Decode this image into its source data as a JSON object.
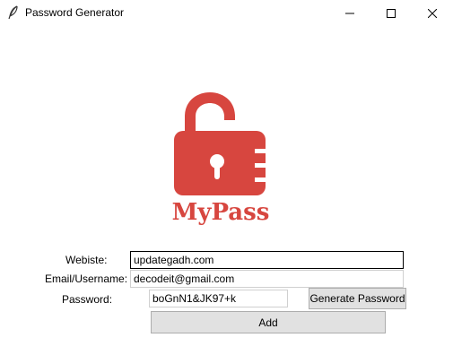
{
  "window": {
    "title": "Password Generator",
    "app_icon": "feather-icon",
    "controls": [
      "minimize-icon",
      "maximize-icon",
      "close-icon"
    ]
  },
  "logo": {
    "icon": "unlocked-padlock-icon",
    "text": "MyPass",
    "color": "#d7463f"
  },
  "form": {
    "website_label": "Webiste:",
    "website_value": "updategadh.com",
    "email_label": "Email/Username:",
    "email_value": "decodeit@gmail.com",
    "password_label": "Password:",
    "password_value": "boGnN1&JK97+k",
    "generate_label": "Generate Password",
    "add_label": "Add"
  }
}
